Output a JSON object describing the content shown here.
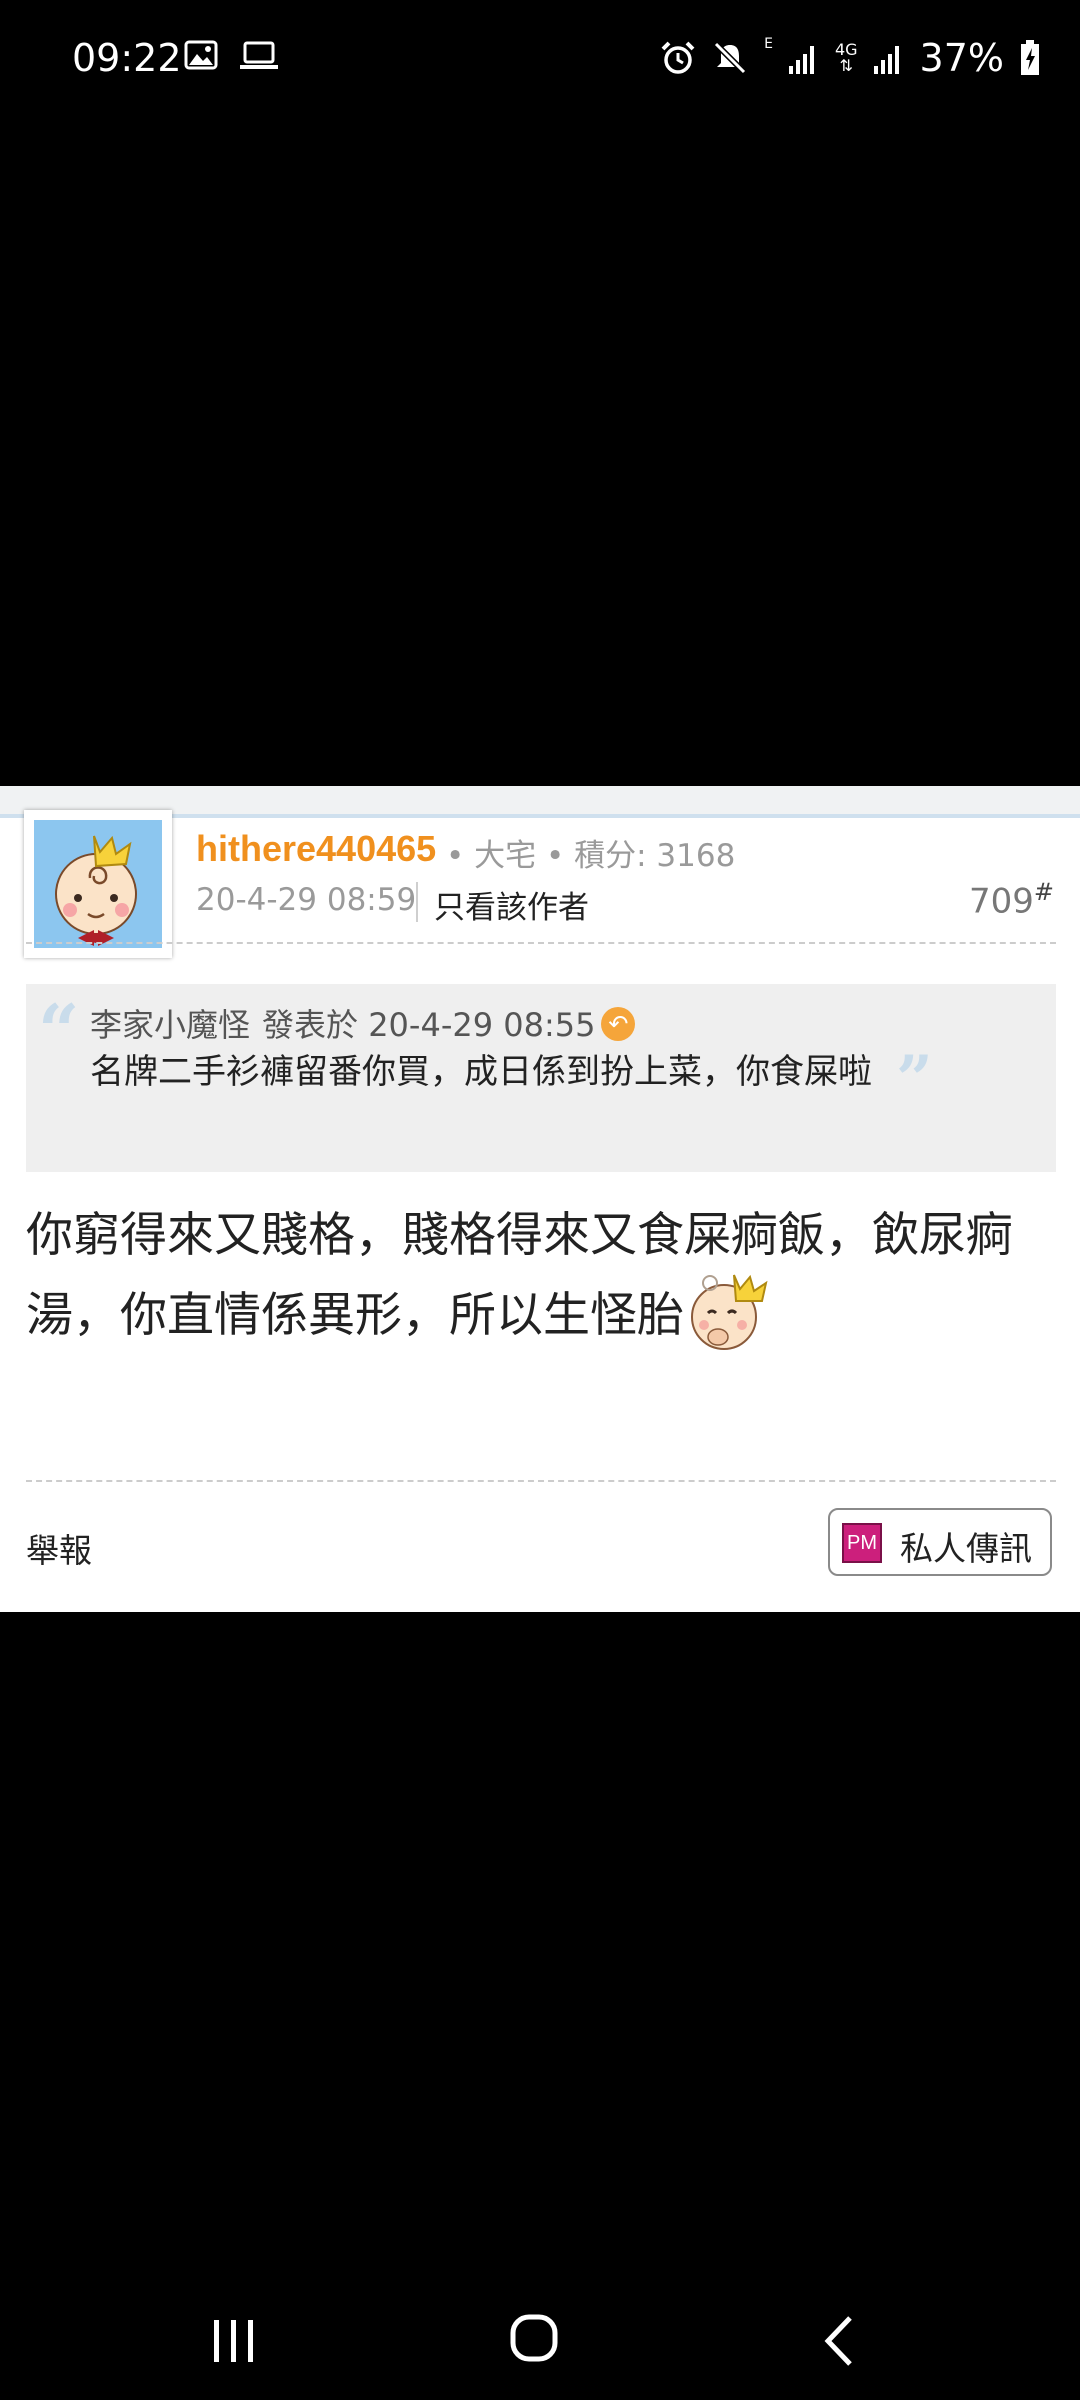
{
  "status_bar": {
    "time": "09:22",
    "left_icons": [
      "image-icon",
      "laptop-icon"
    ],
    "right_icons": [
      "alarm-icon",
      "mute-icon",
      "signal-icon",
      "signal-icon"
    ],
    "network_e": "E",
    "network_4g": "4G",
    "battery_percent": "37%"
  },
  "post": {
    "username": "hithere440465",
    "user_meta": "• 大宅 • 積分: 3168",
    "date": "20-4-29 08:59",
    "only_author": "只看該作者",
    "floor": "709",
    "floor_mark": "#",
    "quote": {
      "author": "李家小魔怪",
      "posted_at": "發表於 20-4-29 08:55",
      "text": "名牌二手衫褲留番你買，成日係到扮上菜，你食屎啦"
    },
    "body": "你窮得來又賤格，賤格得來又食屎痾飯，飲尿痾湯，你直情係異形，所以生怪胎",
    "report": "舉報",
    "pm_icon_text": "PM",
    "pm_label": "私人傳訊"
  },
  "colors": {
    "username": "#f0901e",
    "pm_icon": "#cc1f7c",
    "quote_bg": "#efefef",
    "avatar_bg": "#8cc6ef"
  }
}
